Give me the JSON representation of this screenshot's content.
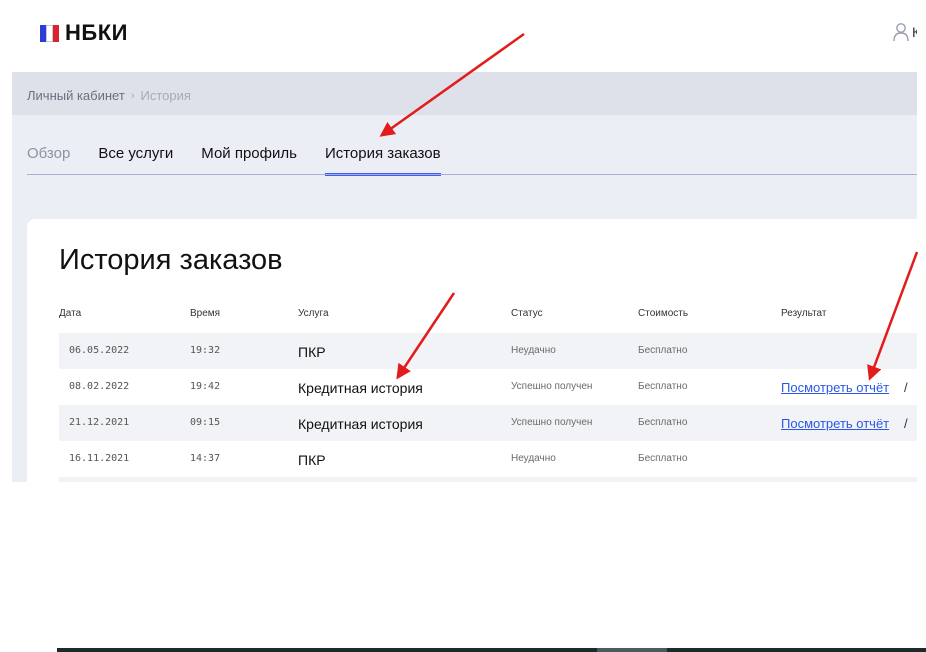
{
  "header": {
    "logo_text": "НБКИ",
    "user_text_cut": "К"
  },
  "breadcrumb": {
    "items": [
      "Личный кабинет",
      "История"
    ],
    "separator": "›"
  },
  "tabs": [
    {
      "label": "Обзор",
      "active": false
    },
    {
      "label": "Все услуги",
      "active": false
    },
    {
      "label": "Мой профиль",
      "active": false
    },
    {
      "label": "История заказов",
      "active": true
    }
  ],
  "page": {
    "title": "История заказов"
  },
  "table": {
    "headers": [
      "Дата",
      "Время",
      "Услуга",
      "Статус",
      "Стоимость",
      "Результат"
    ],
    "rows": [
      {
        "date": "06.05.2022",
        "time": "19:32",
        "service": "ПКР",
        "status": "Неудачно",
        "cost": "Бесплатно",
        "result": "",
        "slash": ""
      },
      {
        "date": "08.02.2022",
        "time": "19:42",
        "service": "Кредитная история",
        "status": "Успешно получен",
        "cost": "Бесплатно",
        "result": "Посмотреть отчёт",
        "slash": "/ "
      },
      {
        "date": "21.12.2021",
        "time": "09:15",
        "service": "Кредитная история",
        "status": "Успешно получен",
        "cost": "Бесплатно",
        "result": "Посмотреть отчёт",
        "slash": "/ "
      },
      {
        "date": "16.11.2021",
        "time": "14:37",
        "service": "ПКР",
        "status": "Неудачно",
        "cost": "Бесплатно",
        "result": "",
        "slash": ""
      }
    ]
  },
  "colors": {
    "accent": "#3d5ef0",
    "link": "#2a57e8",
    "annotation_arrow": "#e21b1b",
    "page_bg": "#eceef5"
  }
}
